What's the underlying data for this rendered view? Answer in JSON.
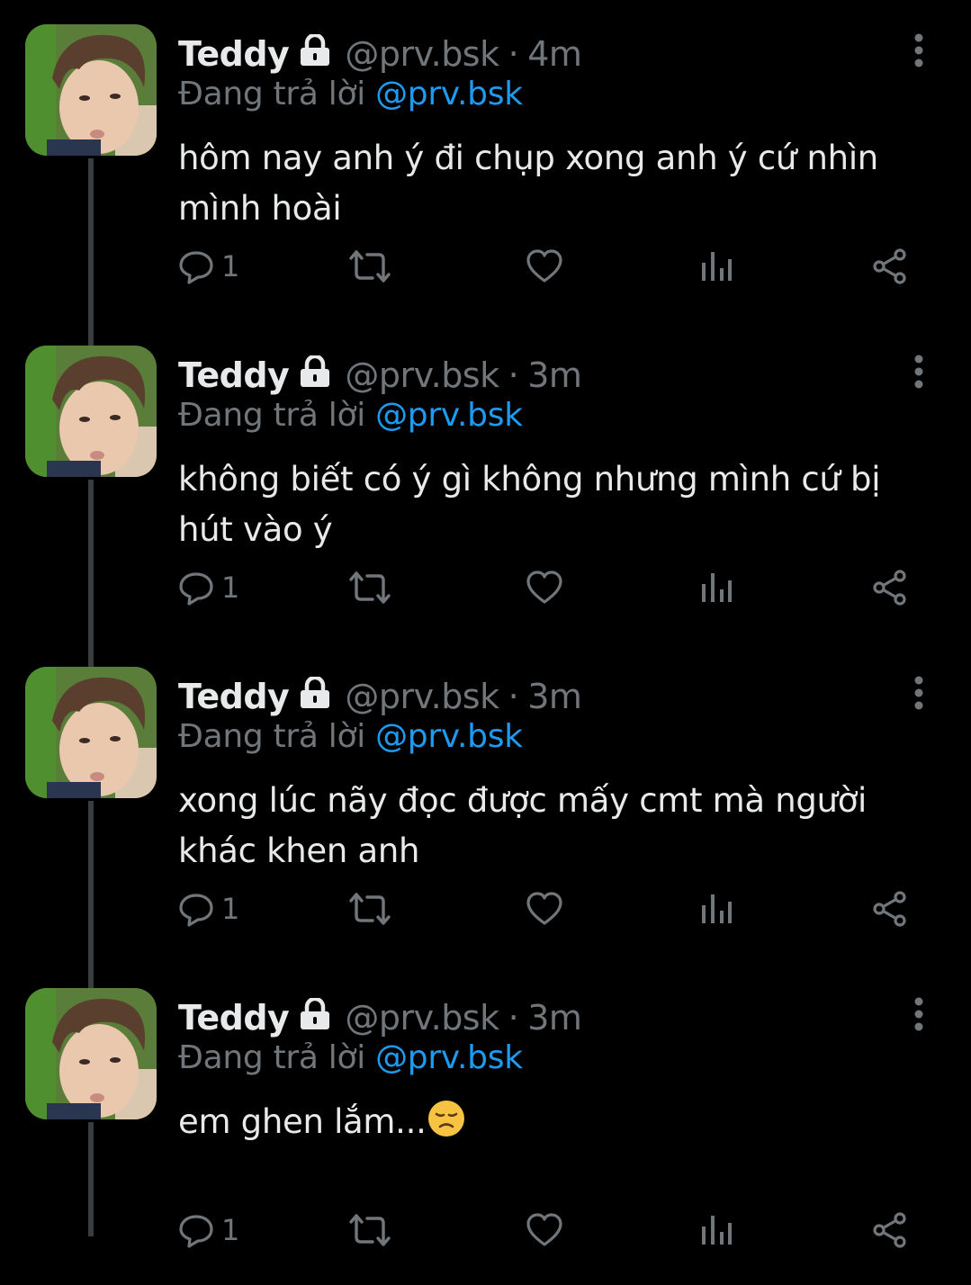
{
  "tweets": [
    {
      "name": "Teddy",
      "handle": "@prv.bsk",
      "separator": "·",
      "time": "4m",
      "reply_prefix": "Đang trả lời",
      "reply_to": "@prv.bsk",
      "text": "hôm nay anh ý đi chụp xong anh ý cứ nhìn mình hoài",
      "reply_count": "1"
    },
    {
      "name": "Teddy",
      "handle": "@prv.bsk",
      "separator": "·",
      "time": "3m",
      "reply_prefix": "Đang trả lời",
      "reply_to": "@prv.bsk",
      "text": "không biết có ý gì không nhưng mình cứ bị hút vào ý",
      "reply_count": "1"
    },
    {
      "name": "Teddy",
      "handle": "@prv.bsk",
      "separator": "·",
      "time": "3m",
      "reply_prefix": "Đang trả lời",
      "reply_to": "@prv.bsk",
      "text": "xong lúc nãy đọc được mấy cmt mà người khác khen anh",
      "reply_count": "1"
    },
    {
      "name": "Teddy",
      "handle": "@prv.bsk",
      "separator": "·",
      "time": "3m",
      "reply_prefix": "Đang trả lời",
      "reply_to": "@prv.bsk",
      "text": "em ghen lắm...",
      "text_emoji": "disappointed-face-emoji",
      "reply_count": "1"
    }
  ],
  "icons": {
    "lock": "lock-icon",
    "more": "more-vertical-icon",
    "reply": "reply-bubble-icon",
    "retweet": "retweet-icon",
    "like": "heart-icon",
    "views": "views-chart-icon",
    "share": "share-icon"
  },
  "colors": {
    "background": "#000000",
    "text": "#e7e9ea",
    "muted": "#71767b",
    "link": "#1d9bf0",
    "thread_line": "#3a3d40"
  }
}
